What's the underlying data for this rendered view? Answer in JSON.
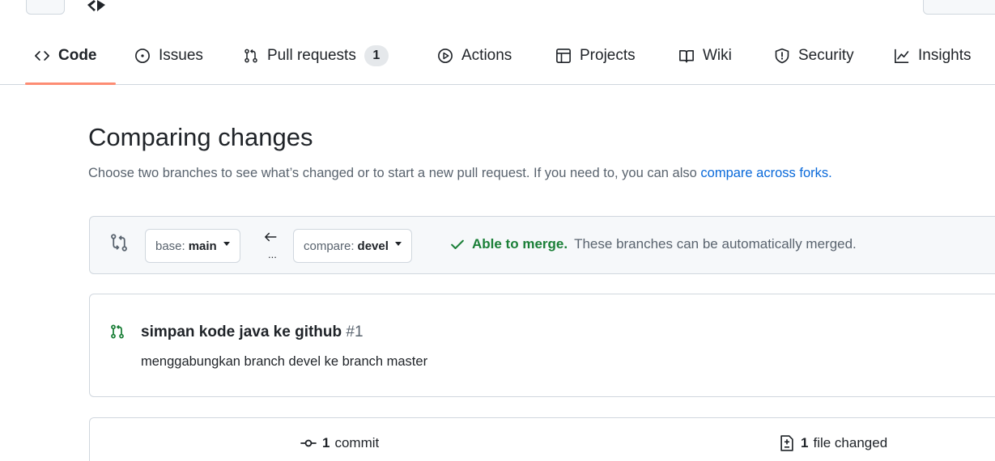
{
  "repo_nav": {
    "tabs": [
      {
        "label": "Code",
        "icon": "code-icon",
        "selected": true
      },
      {
        "label": "Issues",
        "icon": "issue-icon"
      },
      {
        "label": "Pull requests",
        "icon": "pull-request-icon",
        "count": "1"
      },
      {
        "label": "Actions",
        "icon": "play-icon"
      },
      {
        "label": "Projects",
        "icon": "table-icon"
      },
      {
        "label": "Wiki",
        "icon": "book-icon"
      },
      {
        "label": "Security",
        "icon": "shield-icon"
      },
      {
        "label": "Insights",
        "icon": "graph-icon"
      }
    ]
  },
  "compare": {
    "title": "Comparing changes",
    "subtitle": "Choose two branches to see what’s changed or to start a new pull request. If you need to, you can also ",
    "subtitle_link": "compare across forks."
  },
  "range": {
    "base_prefix": "base:",
    "base_branch": "main",
    "arrow": "←",
    "dots": "...",
    "compare_prefix": "compare:",
    "compare_branch": "devel",
    "merge_ok": "Able to merge.",
    "merge_text": "These branches can be automatically merged."
  },
  "pull_request": {
    "title": "simpan kode java ke github",
    "number": "#1",
    "description": "menggabungkan branch devel ke branch master"
  },
  "summary": {
    "commits_count": "1",
    "commits_label": "commit",
    "files_count": "1",
    "files_label": "file changed"
  },
  "colors": {
    "accent_underline": "#fd8c73",
    "success": "#1a7f37",
    "link": "#0969da",
    "border": "#d0d7de",
    "muted_bg": "#f6f8fa"
  }
}
